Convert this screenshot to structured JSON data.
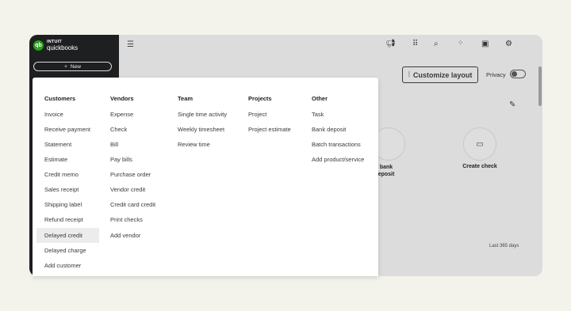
{
  "brand": {
    "line1": "INTUIT",
    "line2": "quickbooks"
  },
  "sidebar": {
    "new_button_label": "New"
  },
  "header": {
    "customize_label": "Customize layout",
    "privacy_label": "Privacy"
  },
  "dashboard": {
    "card1_left_label_top": "bank",
    "card1_left_label_bottom": "eposit",
    "create_check_label": "Create check",
    "period_label": "Last 365 days"
  },
  "menu": {
    "customers": {
      "heading": "Customers",
      "items": [
        "Invoice",
        "Receive payment",
        "Statement",
        "Estimate",
        "Credit memo",
        "Sales receipt",
        "Shipping label",
        "Refund receipt",
        "Delayed credit",
        "Delayed charge",
        "Add customer"
      ]
    },
    "vendors": {
      "heading": "Vendors",
      "items": [
        "Expense",
        "Check",
        "Bill",
        "Pay bills",
        "Purchase order",
        "Vendor credit",
        "Credit card credit",
        "Print checks",
        "Add vendor"
      ]
    },
    "team": {
      "heading": "Team",
      "items": [
        "Single time activity",
        "Weekly timesheet",
        "Review time"
      ]
    },
    "projects": {
      "heading": "Projects",
      "items": [
        "Project",
        "Project estimate"
      ]
    },
    "other": {
      "heading": "Other",
      "items": [
        "Task",
        "Bank deposit",
        "Batch transactions",
        "Add product/service"
      ]
    },
    "highlighted_item": "Delayed credit"
  }
}
